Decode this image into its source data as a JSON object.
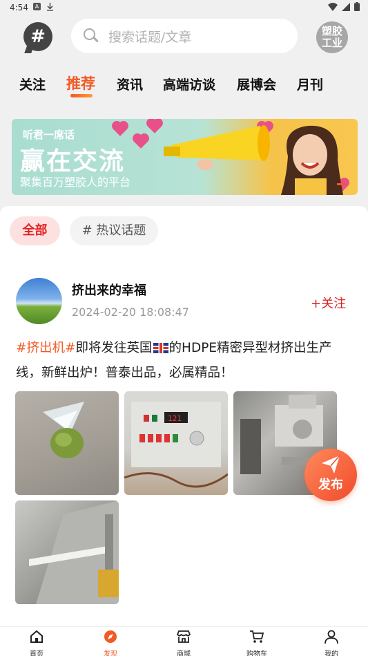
{
  "status_bar": {
    "time": "4:54"
  },
  "header": {
    "topic_icon": "hashtag-icon",
    "search_placeholder": "搜索话题/文章",
    "brand_logo_text": [
      "塑胶",
      "工业"
    ]
  },
  "tabs": [
    {
      "label": "关注",
      "active": false
    },
    {
      "label": "推荐",
      "active": true
    },
    {
      "label": "资讯",
      "active": false
    },
    {
      "label": "高端访谈",
      "active": false
    },
    {
      "label": "展博会",
      "active": false
    },
    {
      "label": "月刊",
      "active": false
    }
  ],
  "banner": {
    "tagline": "听君一席话",
    "headline": "赢在交流",
    "subline": "聚集百万塑胶人的平台"
  },
  "filters": {
    "all": "全部",
    "hot": "# 热议话题"
  },
  "post": {
    "username": "挤出来的幸福",
    "time": "2024-02-20 18:08:47",
    "follow_label": "+关注",
    "hashtag": "#挤出机#",
    "text_before_flag": "即将发往英国",
    "text_after_flag": "的HDPE精密异型材挤出生产线，新鲜出炉！普泰出品，必属精品！",
    "photo_count": 4
  },
  "publish_button": {
    "label": "发布"
  },
  "bottom_nav": [
    {
      "label": "首页",
      "icon": "home-icon",
      "active": false
    },
    {
      "label": "发现",
      "icon": "compass-icon",
      "active": true
    },
    {
      "label": "商城",
      "icon": "store-icon",
      "active": false
    },
    {
      "label": "购物车",
      "icon": "cart-icon",
      "active": false
    },
    {
      "label": "我的",
      "icon": "user-icon",
      "active": false
    }
  ],
  "colors": {
    "accent": "#f15a24",
    "follow": "#e02020"
  }
}
